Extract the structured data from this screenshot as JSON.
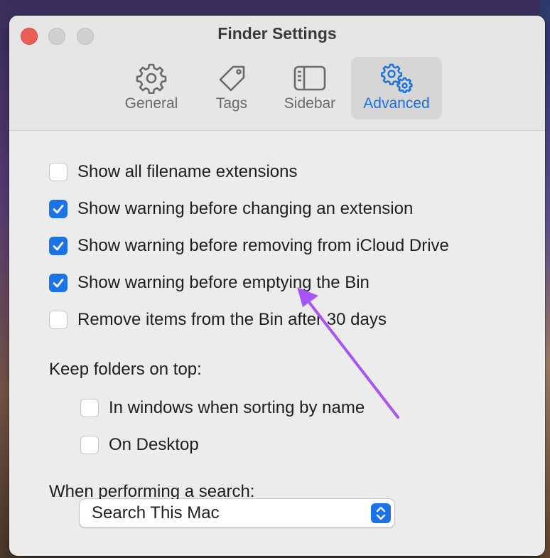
{
  "window": {
    "title": "Finder Settings"
  },
  "tabs": [
    {
      "label": "General",
      "icon": "gear-icon",
      "active": false
    },
    {
      "label": "Tags",
      "icon": "tag-icon",
      "active": false
    },
    {
      "label": "Sidebar",
      "icon": "sidebar-icon",
      "active": false
    },
    {
      "label": "Advanced",
      "icon": "gears-icon",
      "active": true
    }
  ],
  "options": [
    {
      "label": "Show all filename extensions",
      "checked": false
    },
    {
      "label": "Show warning before changing an extension",
      "checked": true
    },
    {
      "label": "Show warning before removing from iCloud Drive",
      "checked": true
    },
    {
      "label": "Show warning before emptying the Bin",
      "checked": true
    },
    {
      "label": "Remove items from the Bin after 30 days",
      "checked": false
    }
  ],
  "keep_folders": {
    "heading": "Keep folders on top:",
    "options": [
      {
        "label": "In windows when sorting by name",
        "checked": false
      },
      {
        "label": "On Desktop",
        "checked": false
      }
    ]
  },
  "search": {
    "heading": "When performing a search:",
    "selected": "Search This Mac"
  },
  "colors": {
    "accent": "#1a73e8",
    "annotation_arrow": "#a855f7"
  }
}
